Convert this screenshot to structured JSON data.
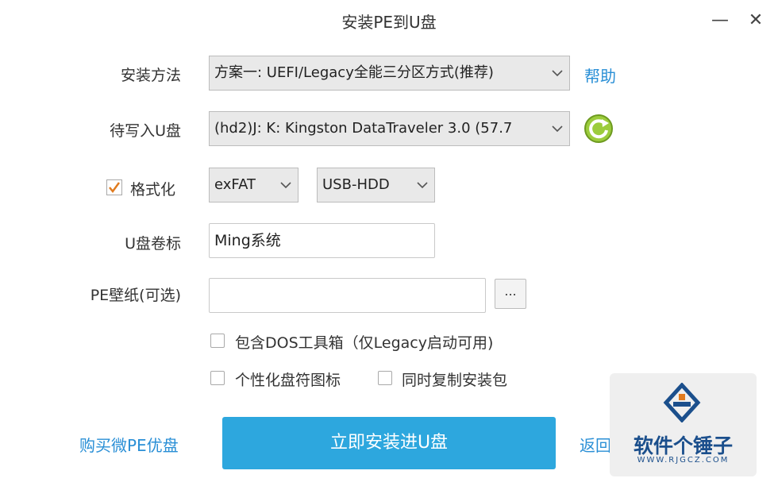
{
  "window": {
    "title": "安装PE到U盘",
    "minimize_glyph": "—",
    "close_glyph": "✕"
  },
  "form": {
    "install_method": {
      "label": "安装方法",
      "value": "方案一:  UEFI/Legacy全能三分区方式(推荐)",
      "help_link": "帮助"
    },
    "target_drive": {
      "label": "待写入U盘",
      "value": "(hd2)J: K: Kingston DataTraveler 3.0 (57.7"
    },
    "format": {
      "checkbox_label": "格式化",
      "checked": true,
      "filesystem": "exFAT",
      "mode": "USB-HDD"
    },
    "volume_label": {
      "label": "U盘卷标",
      "value": "Ming系统"
    },
    "wallpaper": {
      "label": "PE壁纸(可选)",
      "value": "",
      "browse_label": "..."
    },
    "options": {
      "include_dos": {
        "label": "包含DOS工具箱（仅Legacy启动可用)",
        "checked": false
      },
      "personalize_icon": {
        "label": "个性化盘符图标",
        "checked": false
      },
      "copy_installer": {
        "label": "同时复制安装包",
        "checked": false
      }
    }
  },
  "footer": {
    "buy_link": "购买微PE优盘",
    "install_button": "立即安装进U盘",
    "back_link": "返回"
  },
  "watermark": {
    "brand": "软件个锤子",
    "url": "WWW.RJGCZ.COM"
  },
  "colors": {
    "accent": "#2da7de",
    "link": "#2a8fd6",
    "check": "#e07b1f",
    "refresh": "#8bc34a"
  },
  "icons": {
    "refresh": "refresh-icon",
    "check": "checkmark-icon",
    "dropdown": "chevron-down-icon"
  }
}
